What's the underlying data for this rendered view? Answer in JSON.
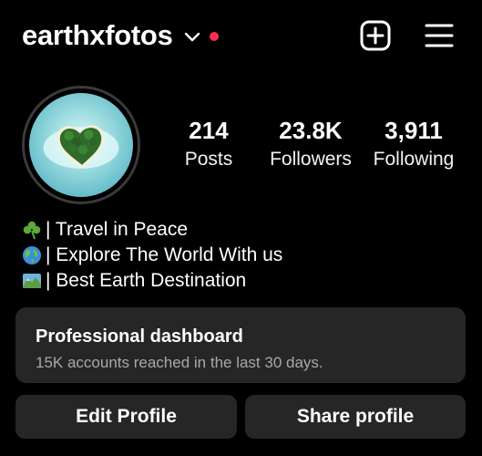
{
  "header": {
    "username": "earthxfotos",
    "icons": {
      "switch": "chevron-down-icon",
      "notification": "red-dot",
      "new_post": "plus-square-icon",
      "menu": "hamburger-menu-icon"
    }
  },
  "profile": {
    "avatar": "heart-shaped-island-photo"
  },
  "stats": [
    {
      "value": "214",
      "label": "Posts"
    },
    {
      "value": "23.8K",
      "label": "Followers"
    },
    {
      "value": "3,911",
      "label": "Following"
    }
  ],
  "bio": [
    {
      "icon": "shamrock-icon",
      "text": "| Travel in Peace"
    },
    {
      "icon": "globe-icon",
      "text": "| Explore The World With us"
    },
    {
      "icon": "map-icon",
      "text": "| Best Earth Destination"
    }
  ],
  "dashboard": {
    "title": "Professional dashboard",
    "subtitle": "15K accounts reached in the last 30 days."
  },
  "buttons": {
    "edit_profile": "Edit Profile",
    "share_profile": "Share profile"
  },
  "colors": {
    "background": "#000000",
    "surface": "#262626",
    "notification_dot": "#ff2d4f",
    "secondary_text": "#a8a8a8"
  }
}
